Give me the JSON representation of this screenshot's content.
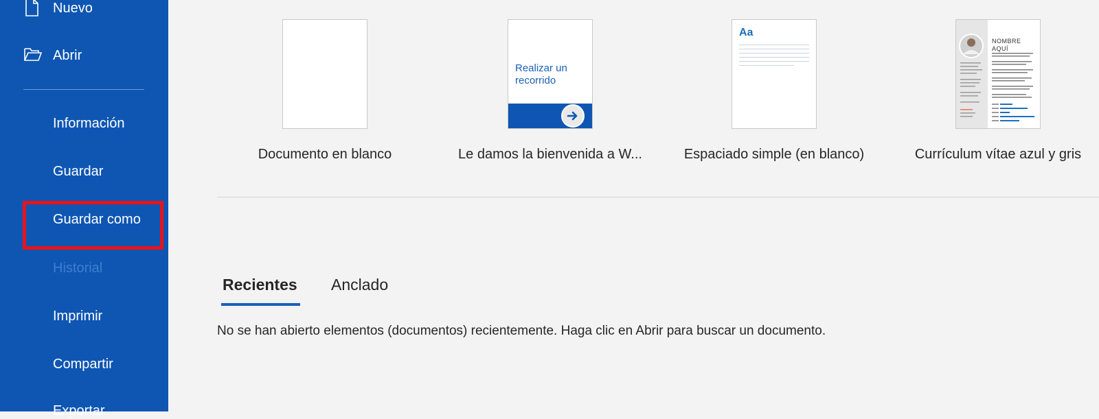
{
  "sidebar": {
    "items": [
      {
        "label": "Nuevo",
        "icon": "new-document-icon"
      },
      {
        "label": "Abrir",
        "icon": "open-folder-icon"
      },
      {
        "label": "Información"
      },
      {
        "label": "Guardar"
      },
      {
        "label": "Guardar como",
        "highlighted": true
      },
      {
        "label": "Historial",
        "disabled": true
      },
      {
        "label": "Imprimir"
      },
      {
        "label": "Compartir"
      },
      {
        "label": "Exportar"
      }
    ]
  },
  "templates": [
    {
      "label": "Documento en blanco"
    },
    {
      "label": "Le damos la bienvenida a W...",
      "thumb_text": "Realizar un recorrido"
    },
    {
      "label": "Espaciado simple (en blanco)",
      "thumb_text": "Aa"
    },
    {
      "label": "Currículum vítae azul y gris",
      "thumb_text": "NOMBRE AQUÍ"
    }
  ],
  "tabs": [
    {
      "label": "Recientes",
      "active": true
    },
    {
      "label": "Anclado"
    }
  ],
  "recent_empty_message": "No se han abierto elementos (documentos) recientemente. Haga clic en Abrir para buscar un documento.",
  "colors": {
    "sidebar_bg": "#0f56b3",
    "highlight_border": "#e8131b",
    "accent": "#1b5fb5",
    "page_bg": "#f3f3f3"
  }
}
